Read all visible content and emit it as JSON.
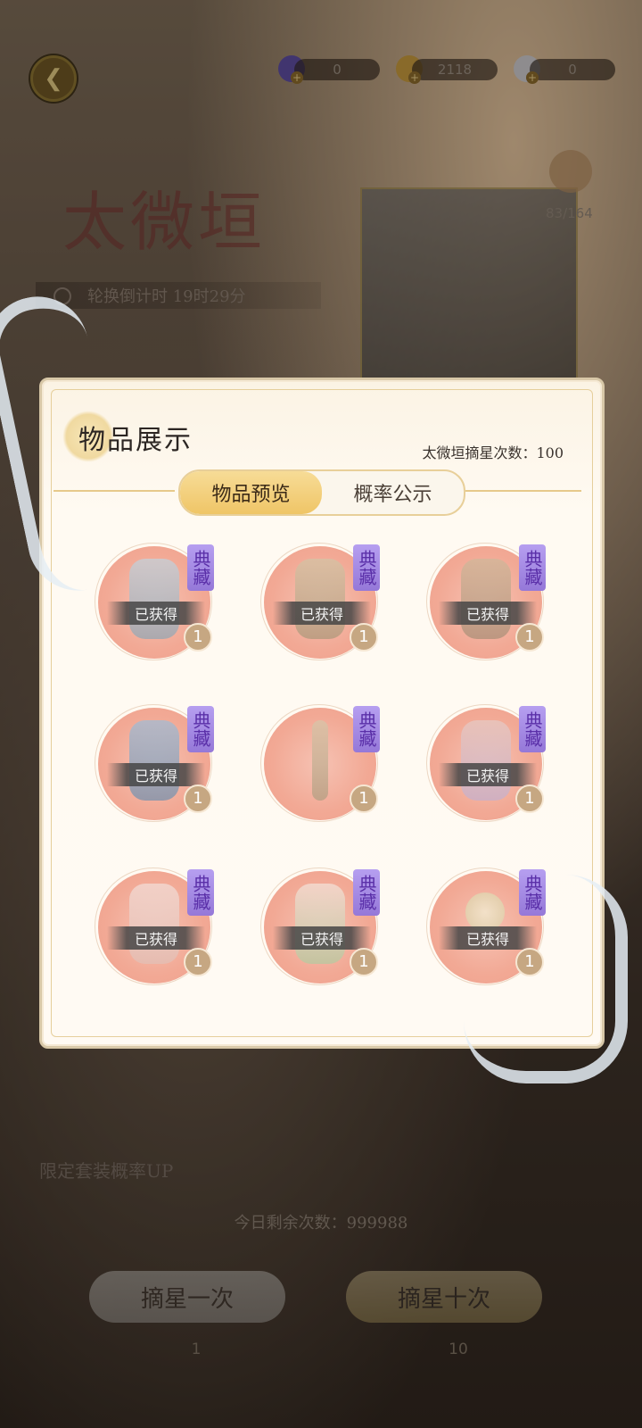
{
  "header": {
    "back_icon": "back-arrow-icon",
    "currencies": [
      {
        "name": "star-stone",
        "value": "0",
        "color": "#5a4aa6"
      },
      {
        "name": "gold-coin",
        "value": "2118",
        "color": "#c89b3d"
      },
      {
        "name": "pearl",
        "value": "0",
        "color": "#cfcfd6"
      }
    ]
  },
  "banner": {
    "title": "太微垣",
    "countdown": "轮换倒计时 19时29分",
    "moon_count": "83/164"
  },
  "panel": {
    "title": "物品展示",
    "star_count_label": "太微垣摘星次数：100",
    "tabs": [
      {
        "label": "物品预览",
        "active": true
      },
      {
        "label": "概率公示",
        "active": false
      }
    ],
    "items": [
      {
        "tag": "典藏",
        "status": "已获得",
        "qty": "1"
      },
      {
        "tag": "典藏",
        "status": "已获得",
        "qty": "1"
      },
      {
        "tag": "典藏",
        "status": "已获得",
        "qty": "1"
      },
      {
        "tag": "典藏",
        "status": "已获得",
        "qty": "1"
      },
      {
        "tag": "典藏",
        "status": "",
        "qty": "1"
      },
      {
        "tag": "典藏",
        "status": "已获得",
        "qty": "1"
      },
      {
        "tag": "典藏",
        "status": "已获得",
        "qty": "1"
      },
      {
        "tag": "典藏",
        "status": "已获得",
        "qty": "1"
      },
      {
        "tag": "典藏",
        "status": "已获得",
        "qty": "1"
      }
    ]
  },
  "bottom": {
    "up_label": "限定套装概率UP",
    "remaining": "今日剩余次数：999988",
    "draw_one": "摘星一次",
    "draw_ten": "摘星十次",
    "cost_one": "1",
    "cost_ten": "10"
  }
}
